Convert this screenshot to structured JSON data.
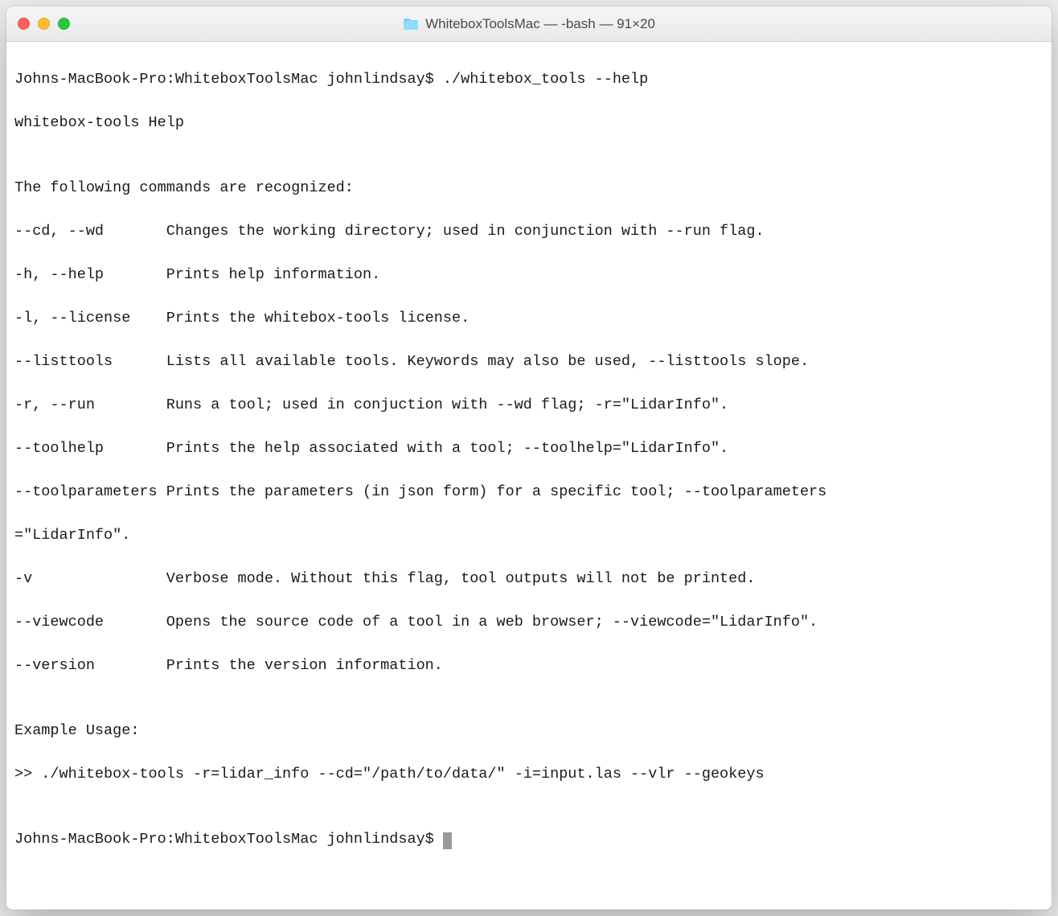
{
  "window": {
    "title": "WhiteboxToolsMac — -bash — 91×20"
  },
  "terminal": {
    "line01": "Johns-MacBook-Pro:WhiteboxToolsMac johnlindsay$ ./whitebox_tools --help",
    "line02": "whitebox-tools Help",
    "line03": "",
    "line04": "The following commands are recognized:",
    "line05": "--cd, --wd       Changes the working directory; used in conjunction with --run flag.",
    "line06": "-h, --help       Prints help information.",
    "line07": "-l, --license    Prints the whitebox-tools license.",
    "line08": "--listtools      Lists all available tools. Keywords may also be used, --listtools slope.",
    "line09": "-r, --run        Runs a tool; used in conjuction with --wd flag; -r=\"LidarInfo\".",
    "line10": "--toolhelp       Prints the help associated with a tool; --toolhelp=\"LidarInfo\".",
    "line11": "--toolparameters Prints the parameters (in json form) for a specific tool; --toolparameters",
    "line12": "=\"LidarInfo\".",
    "line13": "-v               Verbose mode. Without this flag, tool outputs will not be printed.",
    "line14": "--viewcode       Opens the source code of a tool in a web browser; --viewcode=\"LidarInfo\".",
    "line15": "--version        Prints the version information.",
    "line16": "",
    "line17": "Example Usage:",
    "line18": ">> ./whitebox-tools -r=lidar_info --cd=\"/path/to/data/\" -i=input.las --vlr --geokeys",
    "line19": "",
    "line20_prompt": "Johns-MacBook-Pro:WhiteboxToolsMac johnlindsay$ "
  }
}
